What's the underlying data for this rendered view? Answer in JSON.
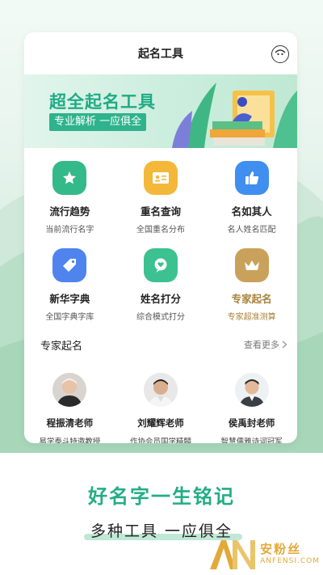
{
  "header": {
    "title": "起名工具",
    "profile_icon": "face-icon"
  },
  "banner": {
    "title": "超全起名工具",
    "tag": "专业解析 一应俱全"
  },
  "tools": [
    {
      "name": "流行趋势",
      "desc": "当前流行名字",
      "icon": "star-icon",
      "color": "#34b98a"
    },
    {
      "name": "重名查询",
      "desc": "全国重名分布",
      "icon": "id-card-icon",
      "color": "#f3b83a"
    },
    {
      "name": "名如其人",
      "desc": "名人姓名匹配",
      "icon": "thumbs-up-icon",
      "color": "#3f8ef0"
    },
    {
      "name": "新华字典",
      "desc": "全国字典字库",
      "icon": "tag-icon",
      "color": "#4f84ee"
    },
    {
      "name": "姓名打分",
      "desc": "综合模式打分",
      "icon": "heart-chat-icon",
      "color": "#3cc190"
    },
    {
      "name": "专家起名",
      "desc": "专家超准测算",
      "icon": "crown-icon",
      "color": "#caa15a"
    }
  ],
  "experts_section": {
    "title": "专家起名",
    "more": "查看更多"
  },
  "experts": [
    {
      "name": "程振清老师",
      "desc": "易学泰斗特邀教授"
    },
    {
      "name": "刘耀辉老师",
      "desc": "作协会员国学精髓"
    },
    {
      "name": "侯禹封老师",
      "desc": "智慧儒雅诗词冠军"
    }
  ],
  "slogan": {
    "line1": "好名字一生铭记",
    "line2": "多种工具 一应俱全"
  },
  "watermark": {
    "cn": "安粉丝",
    "en": "ANFENSI.COM"
  },
  "colors": {
    "primary": "#23ad86",
    "gold": "#a8823a"
  }
}
